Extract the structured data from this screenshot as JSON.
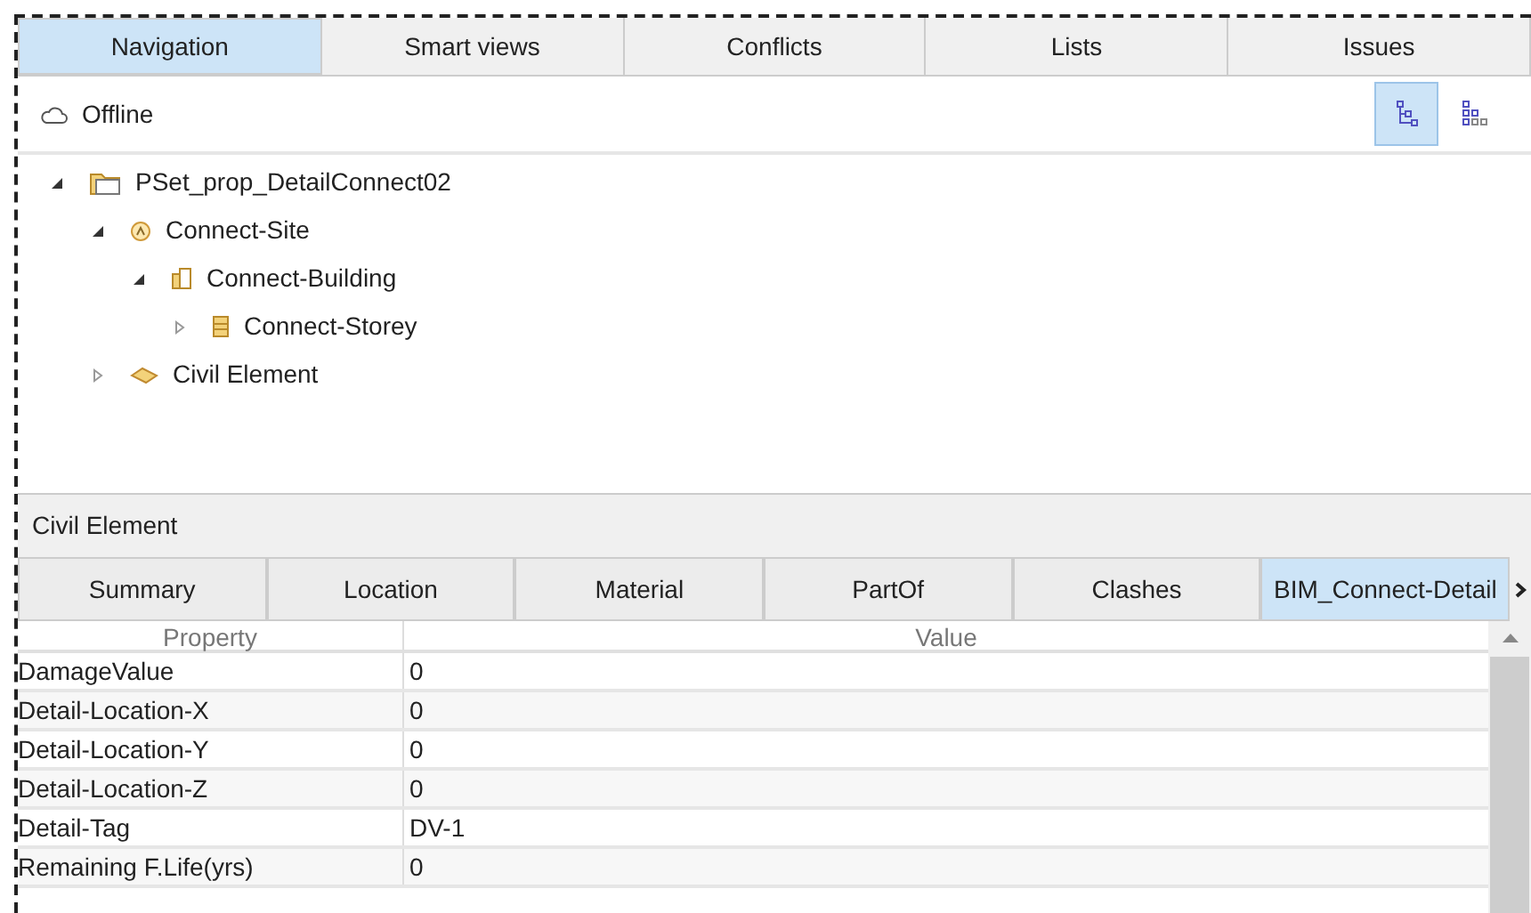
{
  "tabs": [
    {
      "label": "Navigation",
      "selected": true
    },
    {
      "label": "Smart views",
      "selected": false
    },
    {
      "label": "Conflicts",
      "selected": false
    },
    {
      "label": "Lists",
      "selected": false
    },
    {
      "label": "Issues",
      "selected": false
    }
  ],
  "status": {
    "label": "Offline"
  },
  "view_buttons": [
    {
      "kind": "tree",
      "selected": true
    },
    {
      "kind": "grid",
      "selected": false
    }
  ],
  "tree": [
    {
      "label": "PSet_prop_DetailConnect02",
      "kind": "project",
      "expanded": true,
      "children": [
        {
          "label": "Connect-Site",
          "kind": "site",
          "expanded": true,
          "children": [
            {
              "label": "Connect-Building",
              "kind": "building",
              "expanded": true,
              "children": [
                {
                  "label": "Connect-Storey",
                  "kind": "storey",
                  "expanded": false
                }
              ]
            }
          ]
        },
        {
          "label": "Civil Element",
          "kind": "element",
          "expanded": false
        }
      ]
    }
  ],
  "details": {
    "title": "Civil Element",
    "tabs": [
      {
        "label": "Summary",
        "selected": false
      },
      {
        "label": "Location",
        "selected": false
      },
      {
        "label": "Material",
        "selected": false
      },
      {
        "label": "PartOf",
        "selected": false
      },
      {
        "label": "Clashes",
        "selected": false
      },
      {
        "label": "BIM_Connect-Detail",
        "selected": true
      }
    ],
    "table": {
      "columns": [
        "Property",
        "Value"
      ],
      "rows": [
        [
          "DamageValue",
          "0"
        ],
        [
          "Detail-Location-X",
          "0"
        ],
        [
          "Detail-Location-Y",
          "0"
        ],
        [
          "Detail-Location-Z",
          "0"
        ],
        [
          "Detail-Tag",
          "DV-1"
        ],
        [
          "Remaining F.Life(yrs)",
          "0"
        ]
      ]
    }
  }
}
